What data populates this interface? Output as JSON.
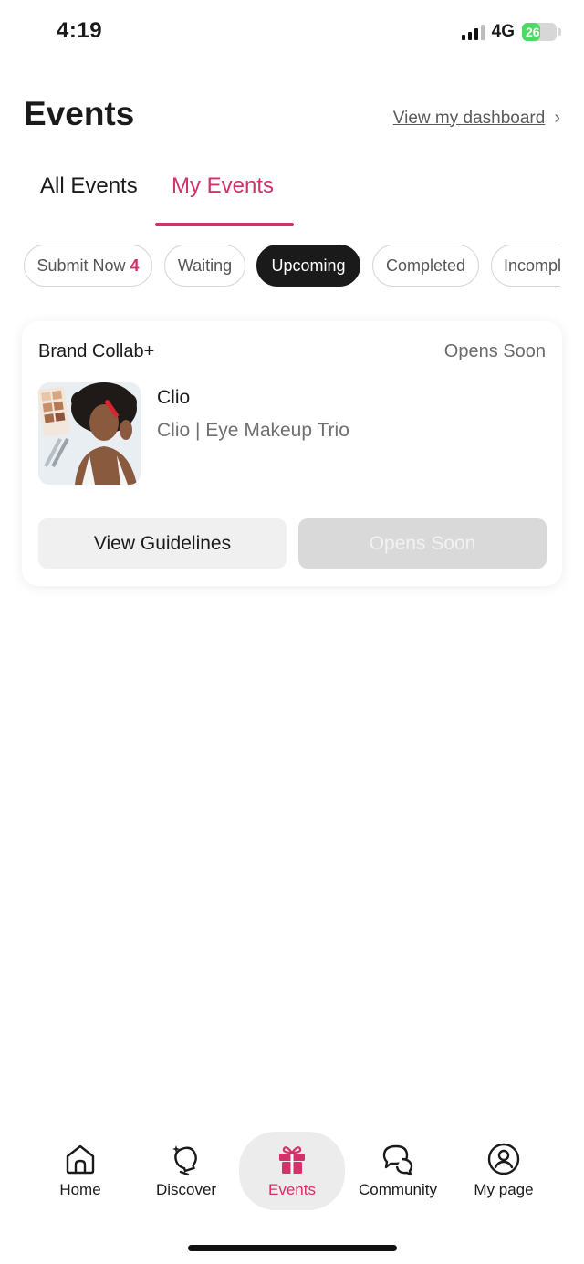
{
  "status_bar": {
    "time": "4:19",
    "network": "4G",
    "battery": "26",
    "battery_level_percent": 26
  },
  "header": {
    "title": "Events",
    "dashboard_link": "View my dashboard"
  },
  "tabs": [
    {
      "label": "All Events",
      "active": false
    },
    {
      "label": "My Events",
      "active": true
    }
  ],
  "filters": [
    {
      "label": "Submit Now",
      "count": "4",
      "active": false
    },
    {
      "label": "Waiting",
      "active": false
    },
    {
      "label": "Upcoming",
      "active": true
    },
    {
      "label": "Completed",
      "active": false
    },
    {
      "label": "Incompl",
      "active": false
    }
  ],
  "event_card": {
    "program": "Brand Collab+",
    "status": "Opens Soon",
    "brand": "Clio",
    "product": "Clio | Eye Makeup Trio",
    "guidelines_button": "View Guidelines",
    "action_button": "Opens Soon"
  },
  "bottom_nav": [
    {
      "label": "Home",
      "icon": "home-icon",
      "active": false
    },
    {
      "label": "Discover",
      "icon": "lightbulb-icon",
      "active": false
    },
    {
      "label": "Events",
      "icon": "gift-icon",
      "active": true
    },
    {
      "label": "Community",
      "icon": "chat-bubbles-icon",
      "active": false
    },
    {
      "label": "My page",
      "icon": "user-circle-icon",
      "active": false
    }
  ],
  "colors": {
    "accent": "#d3316a",
    "active_chip": "#1a1a1a",
    "battery": "#4cd964"
  }
}
